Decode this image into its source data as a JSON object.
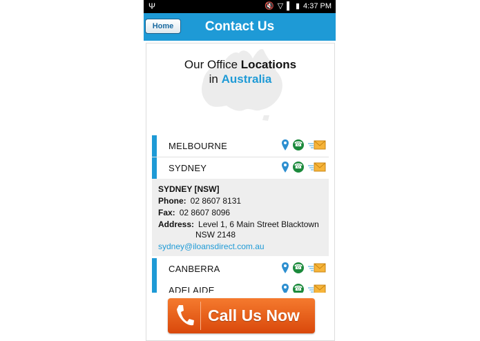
{
  "status_bar": {
    "time": "4:37 PM",
    "usb_icon": "usb-icon",
    "battery_icon": "battery-icon"
  },
  "header": {
    "home_label": "Home",
    "title": "Contact Us"
  },
  "hero": {
    "line1_prefix": "Our Office ",
    "line1_bold": "Locations",
    "line2_prefix": "in ",
    "line2_accent": "Australia"
  },
  "locations": [
    {
      "name": "MELBOURNE"
    },
    {
      "name": "SYDNEY"
    },
    {
      "name": "CANBERRA"
    },
    {
      "name": "ADELAIDE"
    }
  ],
  "details": {
    "title": "SYDNEY [NSW]",
    "phone_label": "Phone:",
    "phone_value": "02 8607 8131",
    "fax_label": "Fax:",
    "fax_value": "02 8607 8096",
    "address_label": "Address:",
    "address_line1": "Level 1, 6 Main Street Blacktown",
    "address_line2": "NSW 2148",
    "email": "sydney@iloansdirect.com.au"
  },
  "call_button": {
    "label": "Call Us Now"
  },
  "colors": {
    "header": "#1e9ad6",
    "accent": "#1e9ad6",
    "call_button": "#e85d1a",
    "phone_icon": "#1c8a3c"
  }
}
